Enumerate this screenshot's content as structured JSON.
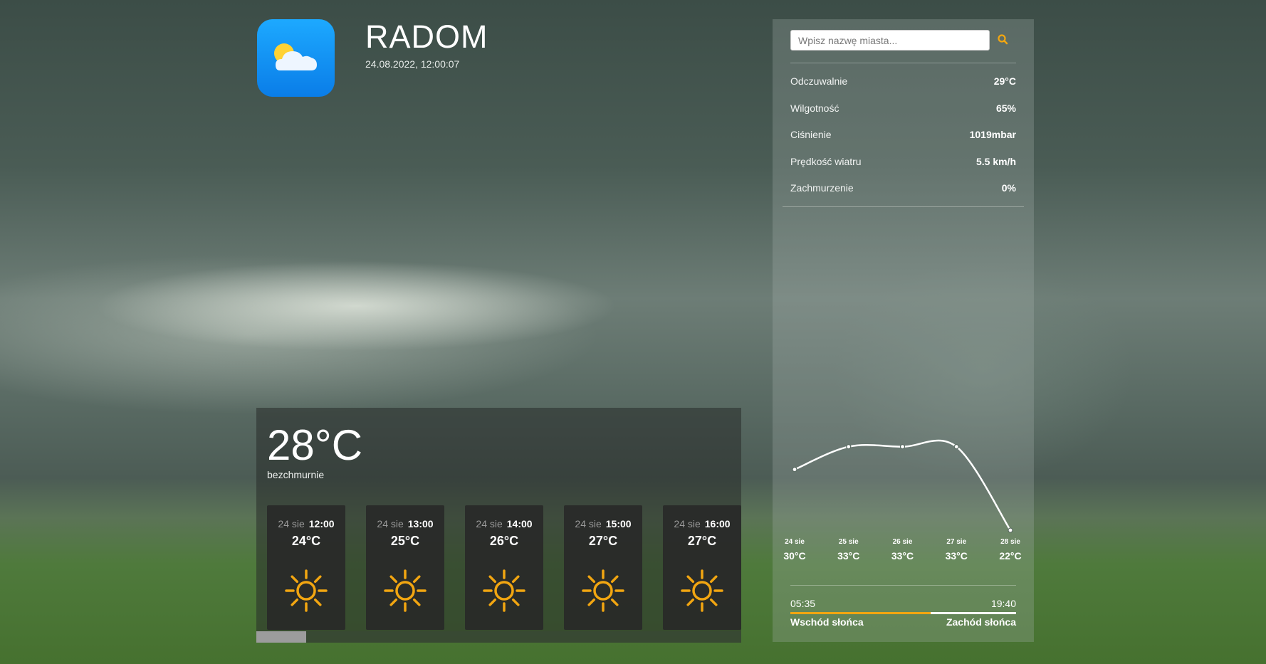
{
  "header": {
    "city": "RADOM",
    "datetime": "24.08.2022, 12:00:07",
    "logo_icon": "partly-cloudy-icon"
  },
  "current": {
    "temperature": "28°C",
    "description": "bezchmurnie"
  },
  "hourly": [
    {
      "date": "24 sie",
      "time": "12:00",
      "temp": "24°C",
      "icon": "sun-icon"
    },
    {
      "date": "24 sie",
      "time": "13:00",
      "temp": "25°C",
      "icon": "sun-icon"
    },
    {
      "date": "24 sie",
      "time": "14:00",
      "temp": "26°C",
      "icon": "sun-icon"
    },
    {
      "date": "24 sie",
      "time": "15:00",
      "temp": "27°C",
      "icon": "sun-icon"
    },
    {
      "date": "24 sie",
      "time": "16:00",
      "temp": "27°C",
      "icon": "sun-icon"
    }
  ],
  "search": {
    "placeholder": "Wpisz nazwę miasta...",
    "value": "",
    "icon": "search-icon"
  },
  "details": [
    {
      "label": "Odczuwalnie",
      "value": "29°C"
    },
    {
      "label": "Wilgotność",
      "value": "65%"
    },
    {
      "label": "Ciśnienie",
      "value": "1019mbar"
    },
    {
      "label": "Prędkość wiatru",
      "value": "5.5 km/h"
    },
    {
      "label": "Zachmurzenie",
      "value": "0%"
    }
  ],
  "chart_data": {
    "type": "line",
    "categories": [
      "24 sie",
      "25 sie",
      "26 sie",
      "27 sie",
      "28 sie"
    ],
    "values": [
      30,
      33,
      33,
      33,
      22
    ],
    "value_labels": [
      "30°C",
      "33°C",
      "33°C",
      "33°C",
      "22°C"
    ],
    "ylim": [
      22,
      34
    ],
    "grid": false
  },
  "sun": {
    "sunrise_time": "05:35",
    "sunset_time": "19:40",
    "sunrise_label": "Wschód słońca",
    "sunset_label": "Zachód słońca",
    "day_progress": 0.62
  },
  "colors": {
    "accent": "#f2a611",
    "logo_blue": "#1da9ff"
  }
}
